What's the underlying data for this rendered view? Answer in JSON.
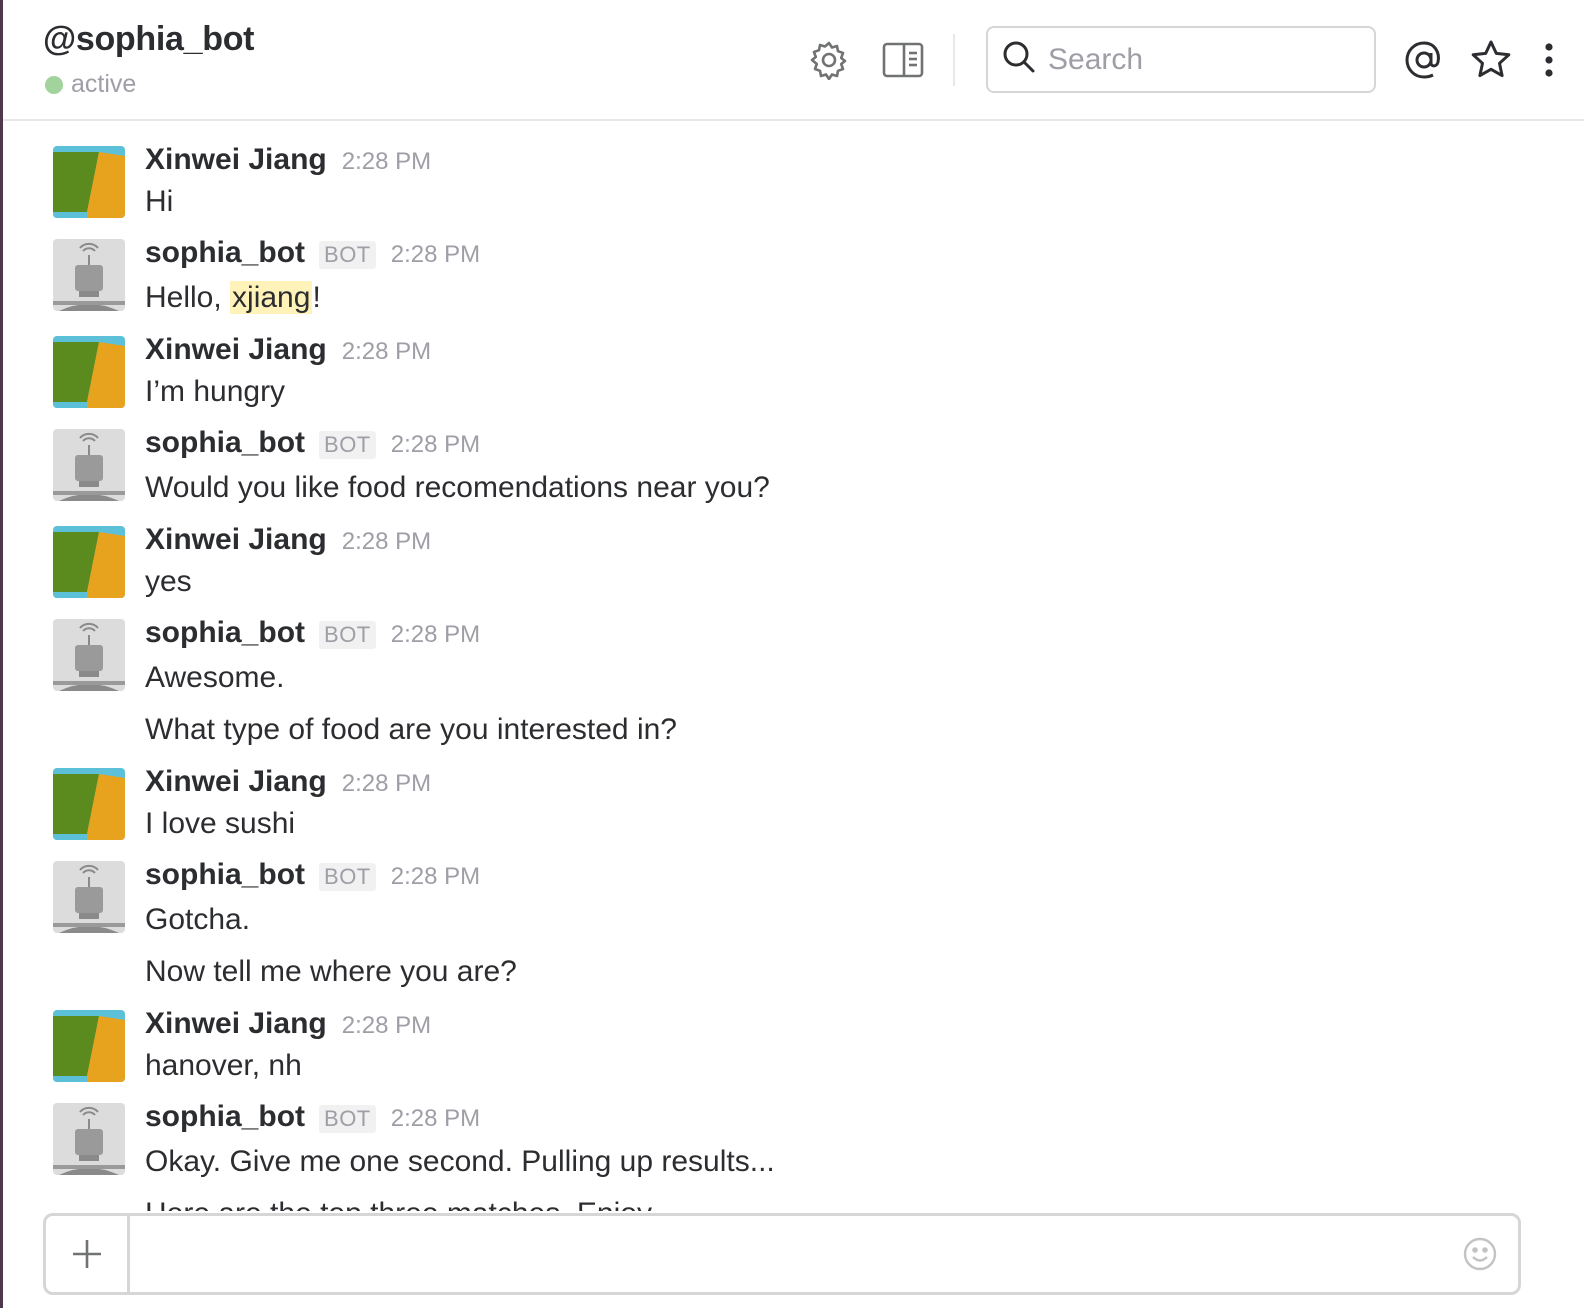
{
  "header": {
    "title": "@sophia_bot",
    "presence": "active",
    "icons": [
      "gear-icon",
      "sidebar-toggle-icon",
      "search-icon",
      "mentions-icon",
      "star-icon",
      "more-vertical-icon"
    ],
    "search": {
      "placeholder": "Search",
      "value": ""
    }
  },
  "messages": {
    "cut_top_text": "",
    "cut_bottom_text": "Here are the top three matches. Enjoy.",
    "items": [
      {
        "author": "Xinwei Jiang",
        "bot": false,
        "time": "2:28 PM",
        "lines": [
          "Hi"
        ]
      },
      {
        "author": "sophia_bot",
        "bot": true,
        "bot_tag": "BOT",
        "time": "2:28 PM",
        "lines": [
          "Hello, "
        ],
        "mention": "xjiang",
        "after_mention": "!"
      },
      {
        "author": "Xinwei Jiang",
        "bot": false,
        "time": "2:28 PM",
        "lines": [
          "I’m hungry"
        ]
      },
      {
        "author": "sophia_bot",
        "bot": true,
        "bot_tag": "BOT",
        "time": "2:28 PM",
        "lines": [
          "Would you like food recomendations near you?"
        ]
      },
      {
        "author": "Xinwei Jiang",
        "bot": false,
        "time": "2:28 PM",
        "lines": [
          "yes"
        ]
      },
      {
        "author": "sophia_bot",
        "bot": true,
        "bot_tag": "BOT",
        "time": "2:28 PM",
        "lines": [
          "Awesome.",
          "What type of food are you interested in?"
        ]
      },
      {
        "author": "Xinwei Jiang",
        "bot": false,
        "time": "2:28 PM",
        "lines": [
          "I love sushi"
        ]
      },
      {
        "author": "sophia_bot",
        "bot": true,
        "bot_tag": "BOT",
        "time": "2:28 PM",
        "lines": [
          "Gotcha.",
          "Now tell me where you are?"
        ]
      },
      {
        "author": "Xinwei Jiang",
        "bot": false,
        "time": "2:28 PM",
        "lines": [
          "hanover, nh"
        ]
      },
      {
        "author": "sophia_bot",
        "bot": true,
        "bot_tag": "BOT",
        "time": "2:28 PM",
        "lines": [
          "Okay. Give me one second. Pulling up results..."
        ]
      }
    ]
  },
  "composer": {
    "value": "",
    "icons": [
      "plus-icon",
      "emoji-icon"
    ]
  },
  "colors": {
    "presence_active": "#a3d39c",
    "mention_highlight": "#fff3b9",
    "sidebar_edge": "#4d394b",
    "avatar_green": "#5b8a1f",
    "avatar_orange": "#e8a31e",
    "avatar_blue": "#5bc0d8"
  }
}
